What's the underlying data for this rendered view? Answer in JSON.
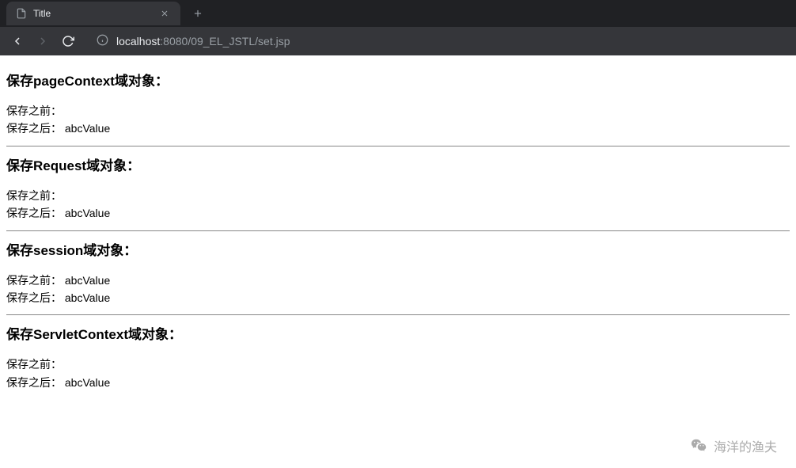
{
  "browser": {
    "tab_title": "Title",
    "url_host": "localhost",
    "url_port": ":8080",
    "url_path": "/09_EL_JSTL/set.jsp"
  },
  "sections": [
    {
      "heading": "保存pageContext域对象：",
      "before_label": "保存之前：",
      "before_value": "",
      "after_label": "保存之后：",
      "after_value": "abcValue"
    },
    {
      "heading": "保存Request域对象：",
      "before_label": "保存之前：",
      "before_value": "",
      "after_label": "保存之后：",
      "after_value": "abcValue"
    },
    {
      "heading": "保存session域对象：",
      "before_label": "保存之前：",
      "before_value": "abcValue",
      "after_label": "保存之后：",
      "after_value": "abcValue"
    },
    {
      "heading": "保存ServletContext域对象：",
      "before_label": "保存之前：",
      "before_value": "",
      "after_label": "保存之后：",
      "after_value": "abcValue"
    }
  ],
  "watermark": {
    "text": "海洋的渔夫"
  }
}
